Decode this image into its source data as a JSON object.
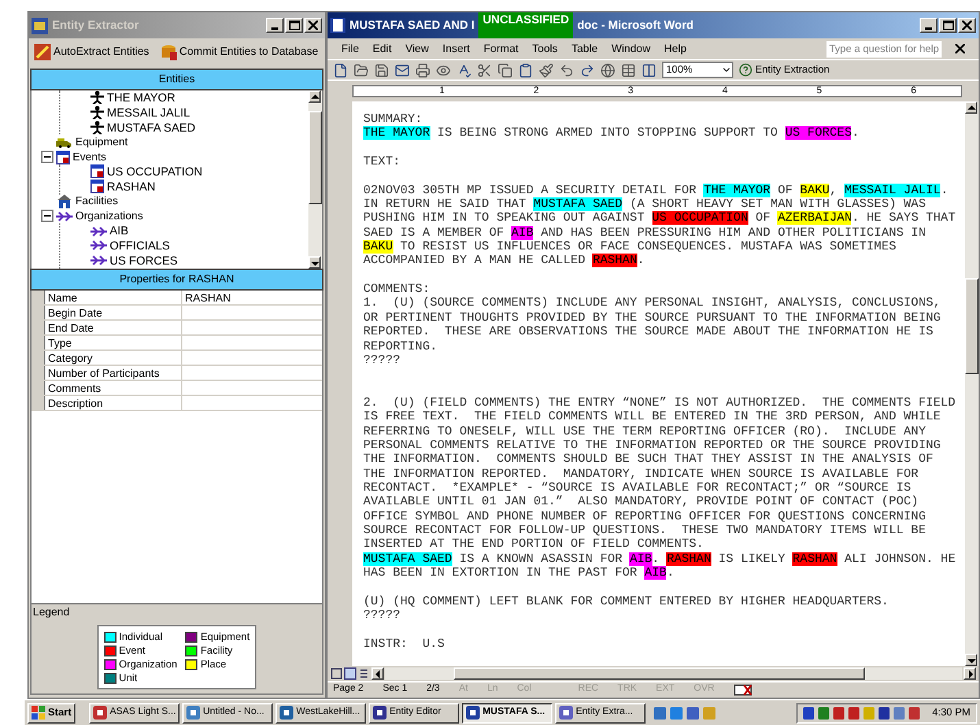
{
  "entity_extractor": {
    "title": "Entity Extractor",
    "toolbar": [
      "AutoExtract Entities",
      "Commit Entities to Database"
    ],
    "entities_header": "Entities",
    "tree": [
      {
        "children": [
          {
            "label": "THE MAYOR",
            "kind": "individual"
          },
          {
            "label": "MESSAIL JALIL",
            "kind": "individual"
          },
          {
            "label": "MUSTAFA SAED",
            "kind": "individual"
          }
        ]
      },
      {
        "label": "Equipment",
        "kind": "equipment"
      },
      {
        "label": "Events",
        "kind": "event",
        "expanded": true,
        "children": [
          {
            "label": "US OCCUPATION",
            "kind": "event"
          },
          {
            "label": "RASHAN",
            "kind": "event"
          }
        ]
      },
      {
        "label": "Facilities",
        "kind": "facility"
      },
      {
        "label": "Organizations",
        "kind": "organization",
        "expanded": true,
        "children": [
          {
            "label": "AIB",
            "kind": "organization"
          },
          {
            "label": "OFFICIALS",
            "kind": "organization"
          },
          {
            "label": "US FORCES",
            "kind": "organization"
          }
        ]
      }
    ],
    "properties_header": "Properties for RASHAN",
    "properties": [
      {
        "name": "Name",
        "value": "RASHAN"
      },
      {
        "name": "Begin Date"
      },
      {
        "name": "End Date"
      },
      {
        "name": "Type"
      },
      {
        "name": "Category"
      },
      {
        "name": "Number of Participants"
      },
      {
        "name": "Comments"
      },
      {
        "name": "Description"
      }
    ],
    "legend": {
      "title": "Legend",
      "items": [
        {
          "label": "Individual",
          "color": "#00ffff"
        },
        {
          "label": "Event",
          "color": "#ff0000"
        },
        {
          "label": "Organization",
          "color": "#ff00ff"
        },
        {
          "label": "Unit",
          "color": "#008080"
        },
        {
          "label": "Equipment",
          "color": "#800080"
        },
        {
          "label": "Facility",
          "color": "#00ff00"
        },
        {
          "label": "Place",
          "color": "#ffff00"
        }
      ]
    }
  },
  "word_window": {
    "title_start": "MUSTAFA SAED AND I",
    "banner": "UNCLASSIFIED",
    "title_end": "doc - Microsoft Word",
    "menu": [
      "File",
      "Edit",
      "View",
      "Insert",
      "Format",
      "Tools",
      "Table",
      "Window",
      "Help"
    ],
    "help_search": {
      "placeholder": "Type a question for help"
    },
    "zoom": "100%",
    "entity_button": "Entity Extraction",
    "ruler": [
      "1",
      "2",
      "3",
      "4",
      "5",
      "6"
    ],
    "document": [
      {
        "segments": [
          {
            "text": "SUMMARY:"
          }
        ]
      },
      {
        "segments": [
          {
            "text": "THE MAYOR",
            "color": "#00ffff"
          },
          {
            "text": " IS BEING STRONG ARMED INTO STOPPING SUPPORT TO "
          },
          {
            "text": "US FORCES",
            "color": "#ff00ff"
          },
          {
            "text": "."
          }
        ]
      },
      {
        "kind": "blank"
      },
      {
        "segments": [
          {
            "text": "TEXT:"
          }
        ]
      },
      {
        "kind": "blank"
      },
      {
        "segments": [
          {
            "text": "02NOV03 305TH MP ISSUED A SECURITY DETAIL FOR "
          },
          {
            "text": "THE MAYOR",
            "color": "#00ffff"
          },
          {
            "text": " OF "
          },
          {
            "text": "BAKU",
            "color": "#ffff00"
          },
          {
            "text": ", "
          },
          {
            "text": "MESSAIL JALIL",
            "color": "#00ffff"
          },
          {
            "text": "."
          }
        ]
      },
      {
        "segments": [
          {
            "text": "IN RETURN HE SAID THAT "
          },
          {
            "text": "MUSTAFA SAED",
            "color": "#00ffff"
          },
          {
            "text": " (A SHORT HEAVY SET MAN WITH GLASSES) WAS"
          }
        ]
      },
      {
        "segments": [
          {
            "text": "PUSHING HIM IN TO SPEAKING OUT AGAINST "
          },
          {
            "text": "US OCCUPATION",
            "color": "#ff0000"
          },
          {
            "text": " OF "
          },
          {
            "text": "AZERBAIJAN",
            "color": "#ffff00"
          },
          {
            "text": ". HE SAYS THAT"
          }
        ]
      },
      {
        "segments": [
          {
            "text": "SAED IS A MEMBER OF "
          },
          {
            "text": "AIB",
            "color": "#ff00ff"
          },
          {
            "text": " AND HAS BEEN PRESSURING HIM AND OTHER POLITICIANS IN"
          }
        ]
      },
      {
        "segments": [
          {
            "text": "BAKU",
            "color": "#ffff00"
          },
          {
            "text": " TO RESIST US INFLUENCES OR FACE CONSEQUENCES. MUSTAFA WAS SOMETIMES"
          }
        ]
      },
      {
        "segments": [
          {
            "text": "ACCOMPANIED BY A MAN HE CALLED "
          },
          {
            "text": "RASHAN",
            "color": "#ff0000"
          },
          {
            "text": "."
          }
        ]
      },
      {
        "kind": "blank"
      },
      {
        "segments": [
          {
            "text": "COMMENTS:"
          }
        ]
      },
      {
        "segments": [
          {
            "text": "1.  (U) (SOURCE COMMENTS) INCLUDE ANY PERSONAL INSIGHT, ANALYSIS, CONCLUSIONS,"
          }
        ]
      },
      {
        "segments": [
          {
            "text": "OR PERTINENT THOUGHTS PROVIDED BY THE SOURCE PURSUANT TO THE INFORMATION BEING"
          }
        ]
      },
      {
        "segments": [
          {
            "text": "REPORTED.  THESE ARE OBSERVATIONS THE SOURCE MADE ABOUT THE INFORMATION HE IS"
          }
        ]
      },
      {
        "segments": [
          {
            "text": "REPORTING."
          }
        ]
      },
      {
        "segments": [
          {
            "text": "?????"
          }
        ]
      },
      {
        "kind": "blank"
      },
      {
        "kind": "blank"
      },
      {
        "segments": [
          {
            "text": "2.  (U) (FIELD COMMENTS) THE ENTRY “NONE” IS NOT AUTHORIZED.  THE COMMENTS FIELD"
          }
        ]
      },
      {
        "segments": [
          {
            "text": "IS FREE TEXT.  THE FIELD COMMENTS WILL BE ENTERED IN THE 3RD PERSON, AND WHILE"
          }
        ]
      },
      {
        "segments": [
          {
            "text": "REFERRING TO ONESELF, WILL USE THE TERM REPORTING OFFICER (RO).  INCLUDE ANY"
          }
        ]
      },
      {
        "segments": [
          {
            "text": "PERSONAL COMMENTS RELATIVE TO THE INFORMATION REPORTED OR THE SOURCE PROVIDING"
          }
        ]
      },
      {
        "segments": [
          {
            "text": "THE INFORMATION.  COMMENTS SHOULD BE SUCH THAT THEY ASSIST IN THE ANALYSIS OF"
          }
        ]
      },
      {
        "segments": [
          {
            "text": "THE INFORMATION REPORTED.  MANDATORY, INDICATE WHEN SOURCE IS AVAILABLE FOR"
          }
        ]
      },
      {
        "segments": [
          {
            "text": "RECONTACT.  *EXAMPLE* - “SOURCE IS AVAILABLE FOR RECONTACT;” OR “SOURCE IS"
          }
        ]
      },
      {
        "segments": [
          {
            "text": "AVAILABLE UNTIL 01 JAN 01.”  ALSO MANDATORY, PROVIDE POINT OF CONTACT (POC)"
          }
        ]
      },
      {
        "segments": [
          {
            "text": "OFFICE SYMBOL AND PHONE NUMBER OF REPORTING OFFICER FOR QUESTIONS CONCERNING"
          }
        ]
      },
      {
        "segments": [
          {
            "text": "SOURCE RECONTACT FOR FOLLOW-UP QUESTIONS.  THESE TWO MANDATORY ITEMS WILL BE"
          }
        ]
      },
      {
        "segments": [
          {
            "text": "INSERTED AT THE END PORTION OF FIELD COMMENTS."
          }
        ]
      },
      {
        "segments": [
          {
            "text": "MUSTAFA SAED",
            "color": "#00ffff"
          },
          {
            "text": " IS A KNOWN ASASSIN FOR "
          },
          {
            "text": "AIB",
            "color": "#ff00ff"
          },
          {
            "text": ". "
          },
          {
            "text": "RASHAN",
            "color": "#ff0000"
          },
          {
            "text": " IS LIKELY "
          },
          {
            "text": "RASHAN",
            "color": "#ff0000"
          },
          {
            "text": " ALI JOHNSON. HE"
          }
        ]
      },
      {
        "segments": [
          {
            "text": "HAS BEEN IN EXTORTION IN THE PAST FOR "
          },
          {
            "text": "AIB",
            "color": "#ff00ff"
          },
          {
            "text": "."
          }
        ]
      },
      {
        "kind": "blank"
      },
      {
        "segments": [
          {
            "text": "(U) (HQ COMMENT) LEFT BLANK FOR COMMENT ENTERED BY HIGHER HEADQUARTERS."
          }
        ]
      },
      {
        "segments": [
          {
            "text": "?????"
          }
        ]
      },
      {
        "kind": "blank"
      },
      {
        "segments": [
          {
            "text": "INSTR:  U.S"
          }
        ]
      }
    ],
    "status_bar": [
      {
        "text": "Page 2",
        "disabled": false
      },
      {
        "text": "Sec 1",
        "disabled": false
      },
      {
        "text": "2/3",
        "disabled": false
      },
      {
        "text": "At",
        "disabled": true
      },
      {
        "text": "Ln",
        "disabled": true
      },
      {
        "text": "Col",
        "disabled": true
      },
      {
        "text": "REC",
        "disabled": true
      },
      {
        "text": "TRK",
        "disabled": true
      },
      {
        "text": "EXT",
        "disabled": true
      },
      {
        "text": "OVR",
        "disabled": true
      }
    ]
  },
  "taskbar": {
    "start": "Start",
    "buttons": [
      {
        "label": "ASAS Light S...",
        "selected": false
      },
      {
        "label": "Untitled - No...",
        "selected": false
      },
      {
        "label": "WestLakeHill...",
        "selected": false
      },
      {
        "label": "Entity Editor",
        "selected": false
      },
      {
        "label": "MUSTAFA S...",
        "selected": true
      },
      {
        "label": "Entity Extra...",
        "selected": false
      }
    ],
    "clock": "4:30 PM"
  }
}
